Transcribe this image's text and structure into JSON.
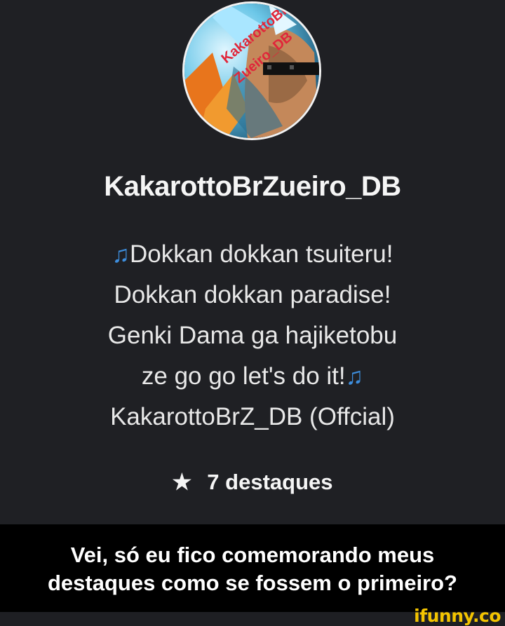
{
  "profile": {
    "avatar_label": "avatar",
    "avatar_overlay_lines": [
      "KakarottoBr",
      "Zueiro_DB"
    ],
    "username": "KakarottoBrZueiro_DB",
    "bio": {
      "note_icon": "♫",
      "line1": "Dokkan dokkan tsuiteru!",
      "line2": "Dokkan dokkan paradise!",
      "line3": "Genki Dama ga hajiketobu",
      "line4": "ze go go let's do it!",
      "line5": "KakarottoBrZ_DB (Offcial)"
    },
    "highlights": {
      "icon": "★",
      "label": "7 destaques"
    }
  },
  "caption": {
    "line1": "Vei, só eu fico comemorando meus",
    "line2": "destaques como se fossem o primeiro?"
  },
  "watermark": "ifunny.co",
  "colors": {
    "background": "#1f2024",
    "caption_bg": "#000000",
    "note_icon": "#3d8ddc",
    "watermark": "#f3c400"
  }
}
